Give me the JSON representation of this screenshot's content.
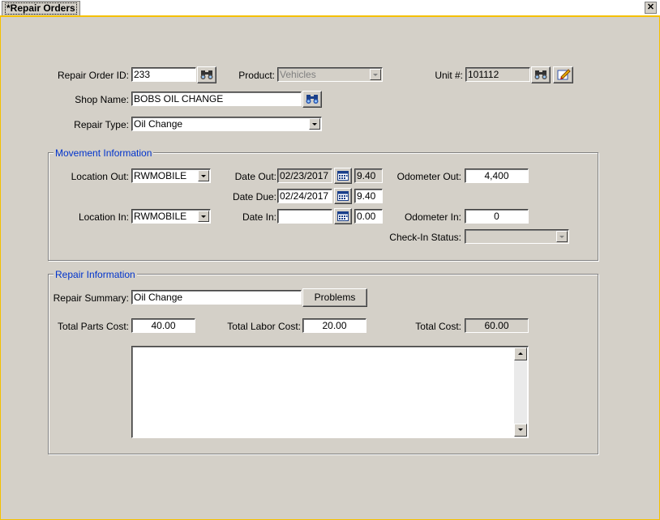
{
  "tab": {
    "title": "*Repair Orders"
  },
  "form": {
    "repair_order_id_label": "Repair Order ID:",
    "repair_order_id": "233",
    "product_label": "Product:",
    "product": "Vehicles",
    "unit_label": "Unit #:",
    "unit": "101112",
    "shop_name_label": "Shop Name:",
    "shop_name": "BOBS OIL CHANGE",
    "repair_type_label": "Repair Type:",
    "repair_type": "Oil Change"
  },
  "movement": {
    "legend": "Movement Information",
    "location_out_label": "Location Out:",
    "location_out": "RWMOBILE",
    "location_in_label": "Location In:",
    "location_in": "RWMOBILE",
    "date_out_label": "Date Out:",
    "date_out": "02/23/2017",
    "time_out": "9.40",
    "date_due_label": "Date Due:",
    "date_due": "02/24/2017",
    "time_due": "9.40",
    "date_in_label": "Date In:",
    "date_in": "",
    "time_in": "0.00",
    "odometer_out_label": "Odometer Out:",
    "odometer_out": "4,400",
    "odometer_in_label": "Odometer In:",
    "odometer_in": "0",
    "checkin_status_label": "Check-In Status:",
    "checkin_status": ""
  },
  "repair": {
    "legend": "Repair Information",
    "summary_label": "Repair Summary:",
    "summary": "Oil Change",
    "problems_button": "Problems",
    "parts_cost_label": "Total Parts Cost:",
    "parts_cost": "40.00",
    "labor_cost_label": "Total Labor Cost:",
    "labor_cost": "20.00",
    "total_cost_label": "Total Cost:",
    "total_cost": "60.00",
    "notes": ""
  },
  "icons": {
    "close": "close-icon",
    "binoculars": "binoculars-icon",
    "calendar": "calendar-icon",
    "edit": "edit-icon"
  }
}
